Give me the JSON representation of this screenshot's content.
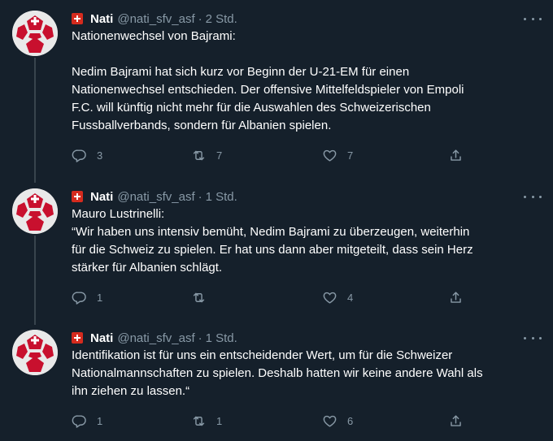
{
  "tweets": [
    {
      "name": "Nati",
      "handle": "@nati_sfv_asf",
      "separator": "·",
      "time": "2 Std.",
      "text": "Nationenwechsel von Bajrami:\n\nNedim Bajrami hat sich kurz vor Beginn der U-21-EM für einen\nNationenwechsel entschieden. Der offensive Mittelfeldspieler von Empoli\nF.C. will künftig nicht mehr für die Auswahlen des Schweizerischen\nFussballverbands, sondern für Albanien spielen.",
      "replies": "3",
      "retweets": "7",
      "likes": "7"
    },
    {
      "name": "Nati",
      "handle": "@nati_sfv_asf",
      "separator": "·",
      "time": "1 Std.",
      "text": "Mauro Lustrinelli:\n“Wir haben uns intensiv bemüht, Nedim Bajrami zu überzeugen, weiterhin\nfür die Schweiz zu spielen. Er hat uns dann aber mitgeteilt, dass sein Herz\nstärker für Albanien schlägt.",
      "replies": "1",
      "retweets": "",
      "likes": "4"
    },
    {
      "name": "Nati",
      "handle": "@nati_sfv_asf",
      "separator": "·",
      "time": "1 Std.",
      "text": "Identifikation ist für uns ein entscheidender Wert, um für die Schweizer\nNationalmannschaften zu spielen. Deshalb hatten wir keine andere Wahl als\nihn ziehen zu lassen.“",
      "replies": "1",
      "retweets": "1",
      "likes": "6"
    }
  ],
  "icons": {
    "avatar": "nati-football-logo",
    "flag": "swiss-flag-icon",
    "more": "more-options-icon",
    "reply": "reply-icon",
    "retweet": "retweet-icon",
    "like": "heart-icon",
    "share": "share-icon"
  },
  "colors": {
    "background": "#15202b",
    "text": "#ffffff",
    "secondary": "#8899a6",
    "thread_line": "#38444d",
    "swiss_red": "#d52b1e"
  }
}
